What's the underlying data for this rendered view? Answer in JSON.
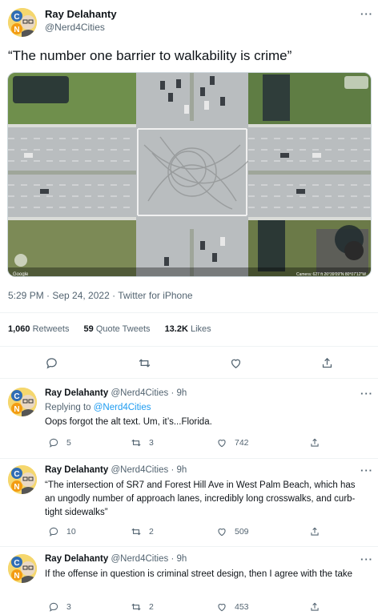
{
  "main_tweet": {
    "author_name": "Ray Delahanty",
    "author_handle": "@Nerd4Cities",
    "text": "“The number one barrier to walkability is crime”",
    "timestamp": "5:29 PM · Sep 24, 2022 · Twitter for iPhone",
    "stats": {
      "retweets": "1,060",
      "retweets_label": "Retweets",
      "quote_tweets": "59",
      "quote_tweets_label": "Quote Tweets",
      "likes": "13.2K",
      "likes_label": "Likes"
    },
    "media": {
      "attribution_left": "Google",
      "attribution_right": "Camera: 627 ft  26°39'09\"N 80°07'12\"W"
    }
  },
  "replies": [
    {
      "author_name": "Ray Delahanty",
      "author_handle": "@Nerd4Cities",
      "time": "· 9h",
      "replying_prefix": "Replying to",
      "replying_to": "@Nerd4Cities",
      "text": "Oops forgot the alt text. Um, it’s...Florida.",
      "replies": "5",
      "retweets": "3",
      "likes": "742"
    },
    {
      "author_name": "Ray Delahanty",
      "author_handle": "@Nerd4Cities",
      "time": "· 9h",
      "text": "“The intersection of SR7 and Forest Hill Ave in West Palm Beach, which has an ungodly number of approach lanes, incredibly long crosswalks, and curb-tight sidewalks”",
      "replies": "10",
      "retweets": "2",
      "likes": "509"
    },
    {
      "author_name": "Ray Delahanty",
      "author_handle": "@Nerd4Cities",
      "time": "· 9h",
      "text": "If the offense in question is criminal street design, then I agree with the take",
      "replies": "3",
      "retweets": "2",
      "likes": "453"
    }
  ],
  "icons": {
    "reply": "reply-icon",
    "retweet": "retweet-icon",
    "like": "heart-icon",
    "share": "share-icon",
    "more": "more-icon"
  }
}
